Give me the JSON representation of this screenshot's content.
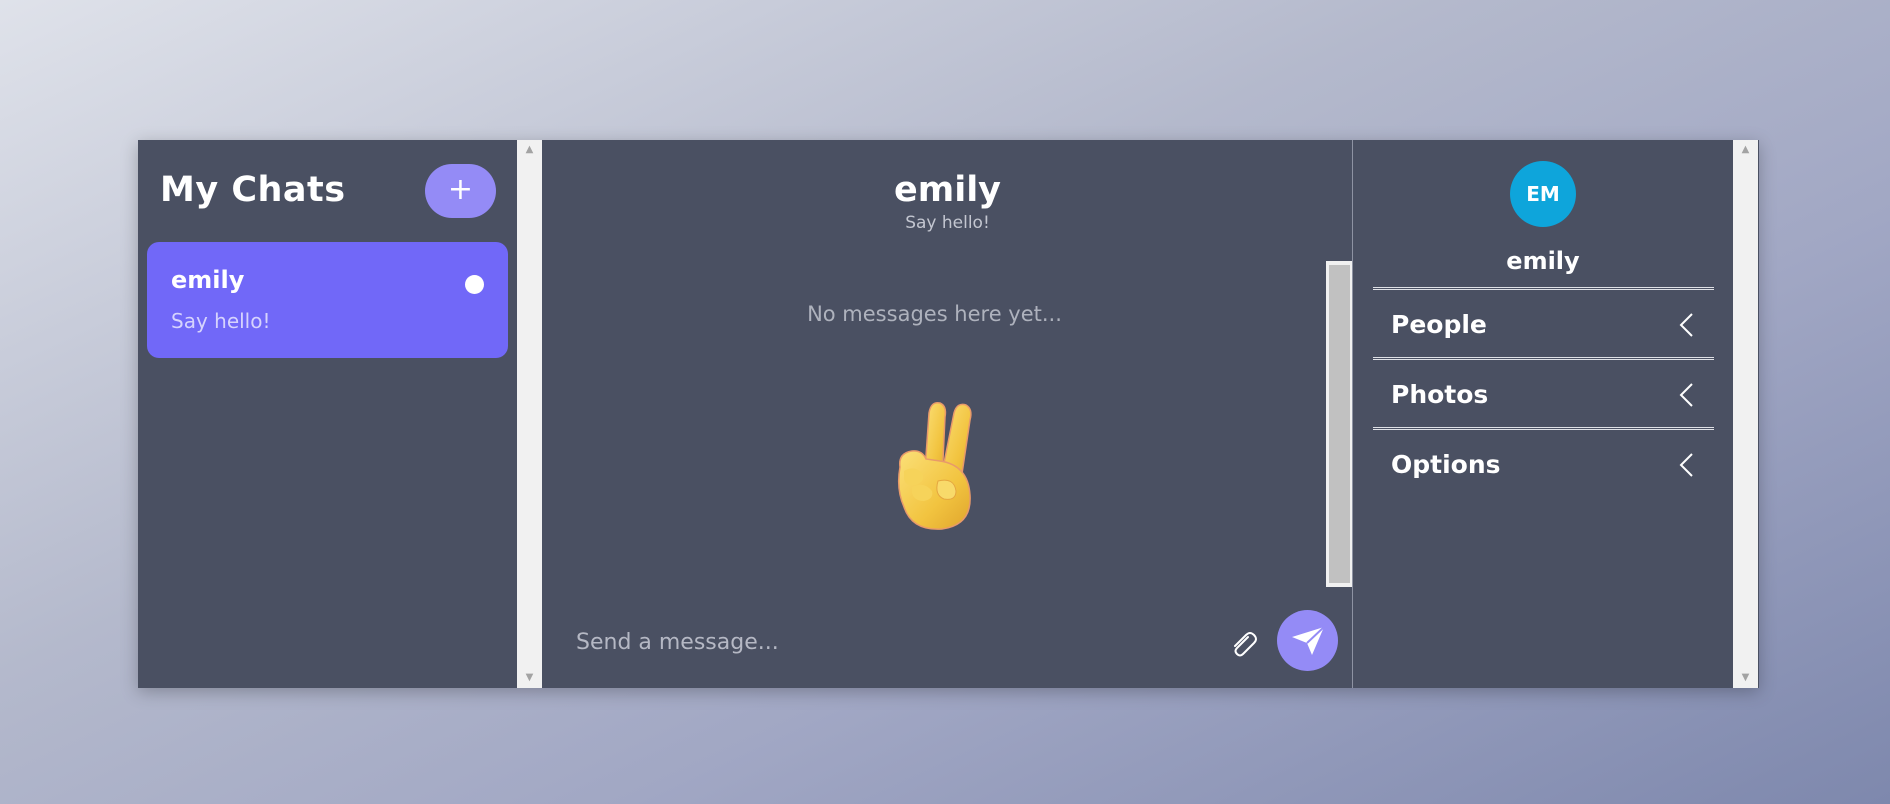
{
  "chat_list": {
    "title": "My Chats",
    "new_chat_label": "+",
    "chats": [
      {
        "name": "emily",
        "preview": "Say hello!",
        "unread": true
      }
    ]
  },
  "chat_feed": {
    "title": "emily",
    "subtitle": "Say hello!",
    "empty_text": "No messages here yet...",
    "emoji": "peace-hand-emoji",
    "input_placeholder": "Send a message..."
  },
  "settings": {
    "avatar_initials": "EM",
    "avatar_color": "#0ea5db",
    "username": "emily",
    "sections": [
      {
        "label": "People"
      },
      {
        "label": "Photos"
      },
      {
        "label": "Options"
      }
    ]
  },
  "colors": {
    "accent": "#7168f8",
    "button": "#948bf6",
    "panel": "#4a5062"
  }
}
